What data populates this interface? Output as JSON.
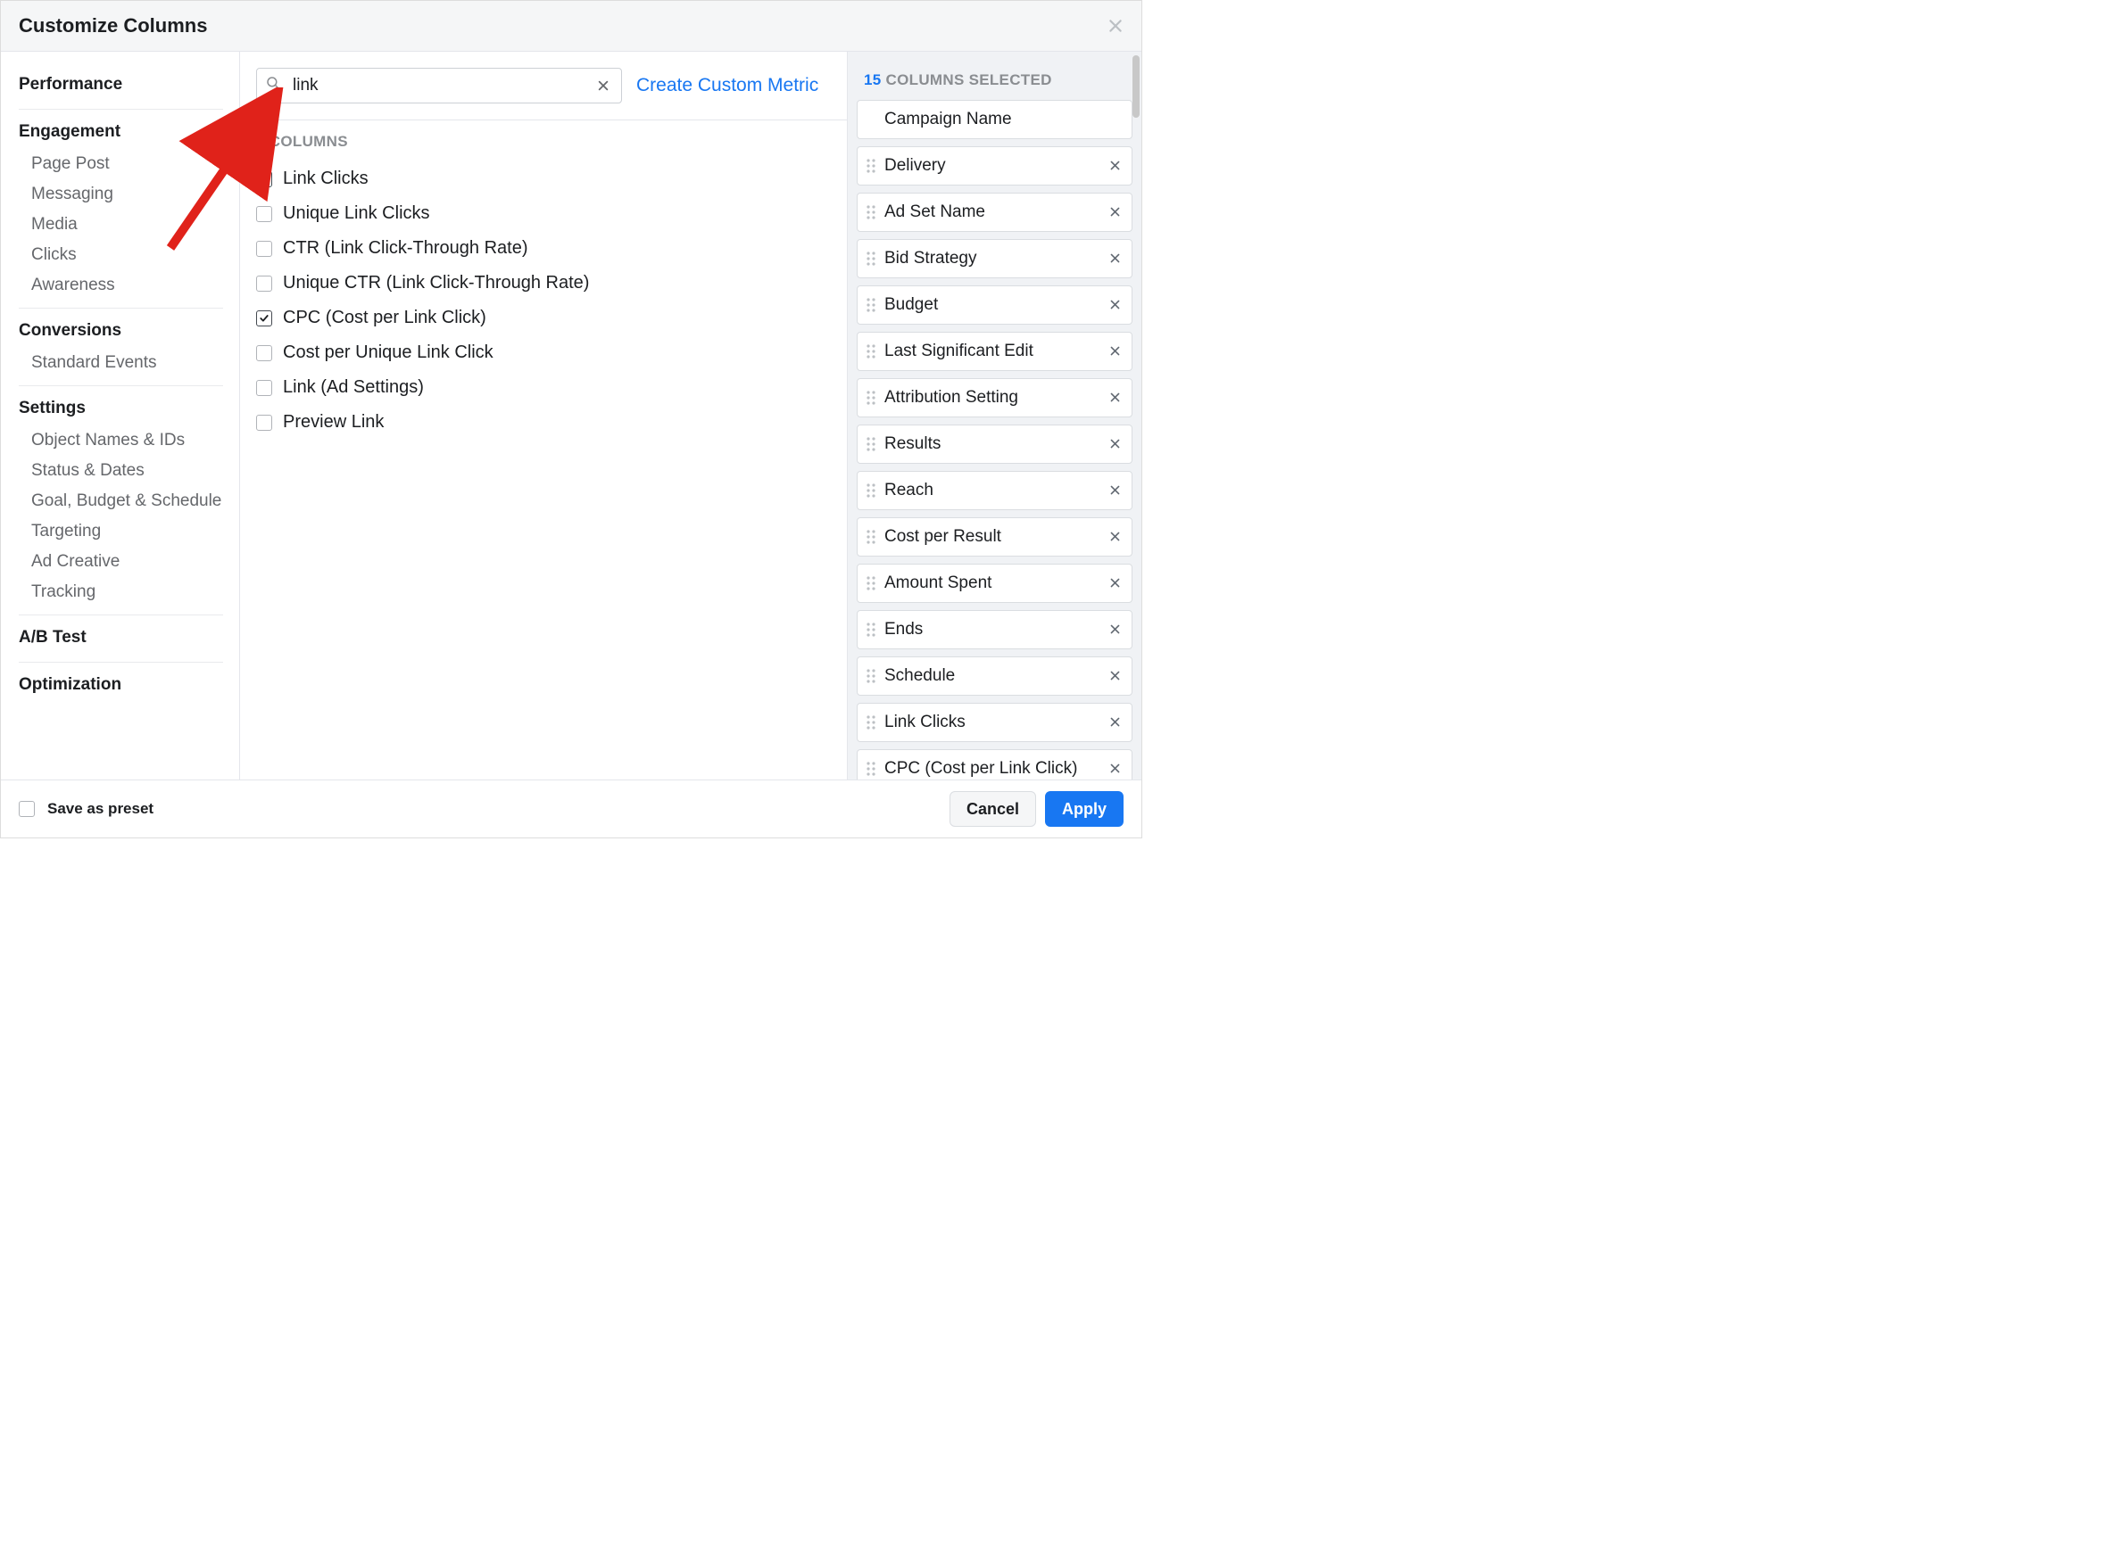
{
  "header": {
    "title": "Customize Columns"
  },
  "sidebar": {
    "groups": [
      {
        "label": "Performance",
        "items": []
      },
      {
        "label": "Engagement",
        "items": [
          "Page Post",
          "Messaging",
          "Media",
          "Clicks",
          "Awareness"
        ]
      },
      {
        "label": "Conversions",
        "items": [
          "Standard Events"
        ]
      },
      {
        "label": "Settings",
        "items": [
          "Object Names & IDs",
          "Status & Dates",
          "Goal, Budget & Schedule",
          "Targeting",
          "Ad Creative",
          "Tracking"
        ]
      },
      {
        "label": "A/B Test",
        "items": []
      },
      {
        "label": "Optimization",
        "items": []
      }
    ]
  },
  "search": {
    "value": "link",
    "create_metric_label": "Create Custom Metric"
  },
  "columns": {
    "count": 8,
    "count_suffix": " COLUMNS",
    "items": [
      {
        "label": "Link Clicks",
        "checked": true
      },
      {
        "label": "Unique Link Clicks",
        "checked": false
      },
      {
        "label": "CTR (Link Click-Through Rate)",
        "checked": false
      },
      {
        "label": "Unique CTR (Link Click-Through Rate)",
        "checked": false
      },
      {
        "label": "CPC (Cost per Link Click)",
        "checked": true
      },
      {
        "label": "Cost per Unique Link Click",
        "checked": false
      },
      {
        "label": "Link (Ad Settings)",
        "checked": false
      },
      {
        "label": "Preview Link",
        "checked": false
      }
    ]
  },
  "selected": {
    "count": 15,
    "count_suffix": " COLUMNS SELECTED",
    "items": [
      {
        "label": "Campaign Name",
        "removable": false,
        "draggable": false
      },
      {
        "label": "Delivery",
        "removable": true,
        "draggable": true
      },
      {
        "label": "Ad Set Name",
        "removable": true,
        "draggable": true
      },
      {
        "label": "Bid Strategy",
        "removable": true,
        "draggable": true
      },
      {
        "label": "Budget",
        "removable": true,
        "draggable": true
      },
      {
        "label": "Last Significant Edit",
        "removable": true,
        "draggable": true
      },
      {
        "label": "Attribution Setting",
        "removable": true,
        "draggable": true
      },
      {
        "label": "Results",
        "removable": true,
        "draggable": true
      },
      {
        "label": "Reach",
        "removable": true,
        "draggable": true
      },
      {
        "label": "Cost per Result",
        "removable": true,
        "draggable": true
      },
      {
        "label": "Amount Spent",
        "removable": true,
        "draggable": true
      },
      {
        "label": "Ends",
        "removable": true,
        "draggable": true
      },
      {
        "label": "Schedule",
        "removable": true,
        "draggable": true
      },
      {
        "label": "Link Clicks",
        "removable": true,
        "draggable": true
      },
      {
        "label": "CPC (Cost per Link Click)",
        "removable": true,
        "draggable": true
      }
    ]
  },
  "footer": {
    "preset_label": "Save as preset",
    "cancel": "Cancel",
    "apply": "Apply"
  },
  "colors": {
    "primary": "#1877f2",
    "text": "#1c1e21",
    "muted": "#65676b",
    "panel": "#f0f2f5",
    "annotation": "#e0221a"
  }
}
